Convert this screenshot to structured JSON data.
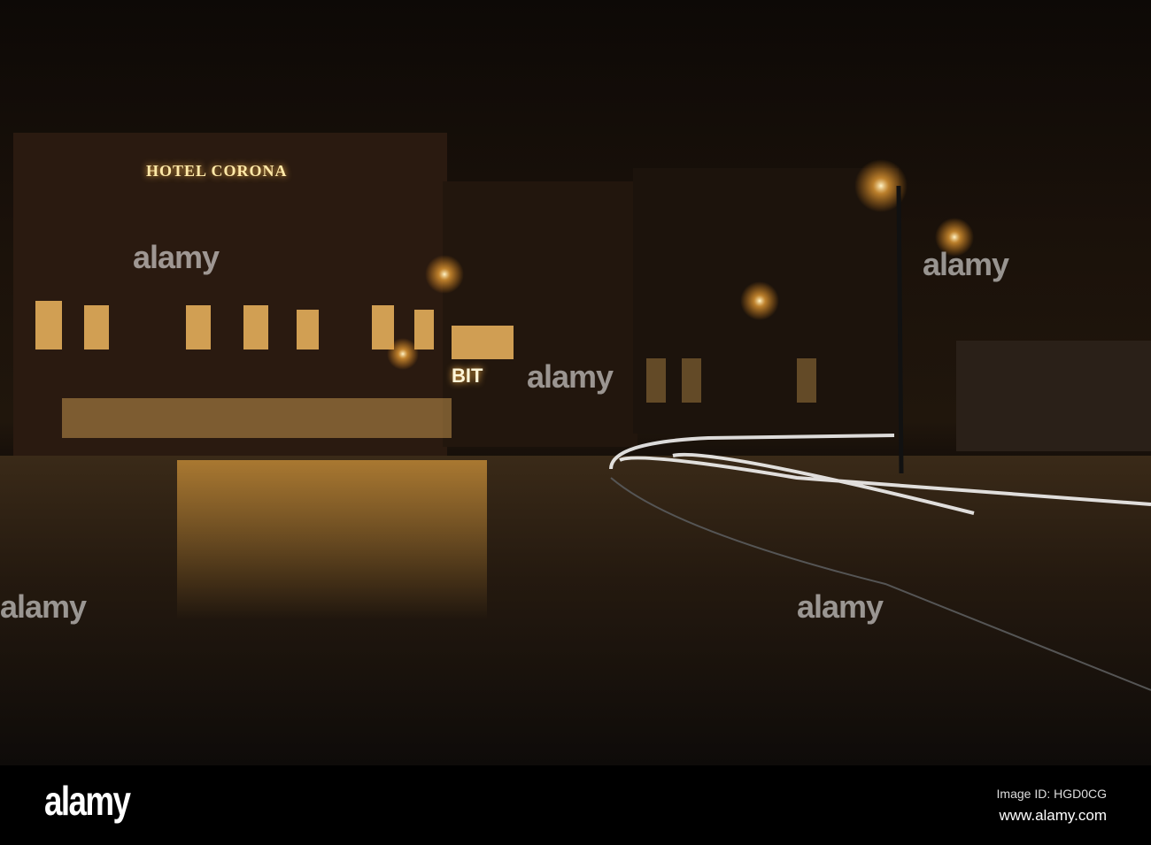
{
  "photo": {
    "signs": {
      "hotel": "HOTEL CORONA",
      "bar": "BIT"
    },
    "watermark": "alamy"
  },
  "footer": {
    "logo": "alamy",
    "image_id": "Image ID: HGD0CG",
    "site": "www.alamy.com"
  }
}
